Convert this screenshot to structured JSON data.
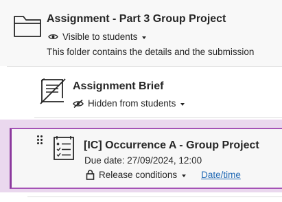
{
  "folder": {
    "title": "Assignment - Part 3 Group Project",
    "visibility": "Visible to students",
    "description": "This folder contains the details and the submission"
  },
  "brief": {
    "title": "Assignment Brief",
    "visibility": "Hidden from students"
  },
  "selected_item": {
    "title": "[IC] Occurrence A - Group Project",
    "due_date": "Due date: 27/09/2024, 12:00",
    "release_conditions": "Release conditions",
    "date_link": "Date/time"
  },
  "icons": {
    "folder": "folder-icon",
    "visible": "eye-icon",
    "hidden": "eye-slash-icon",
    "document": "document-icon",
    "test": "checklist-icon",
    "lock": "lock-icon",
    "drag": "drag-handle-icon"
  },
  "colors": {
    "highlight_background": "#ead8ee",
    "selected_border": "#a553b6",
    "link": "#2069b5",
    "text": "#262626"
  }
}
